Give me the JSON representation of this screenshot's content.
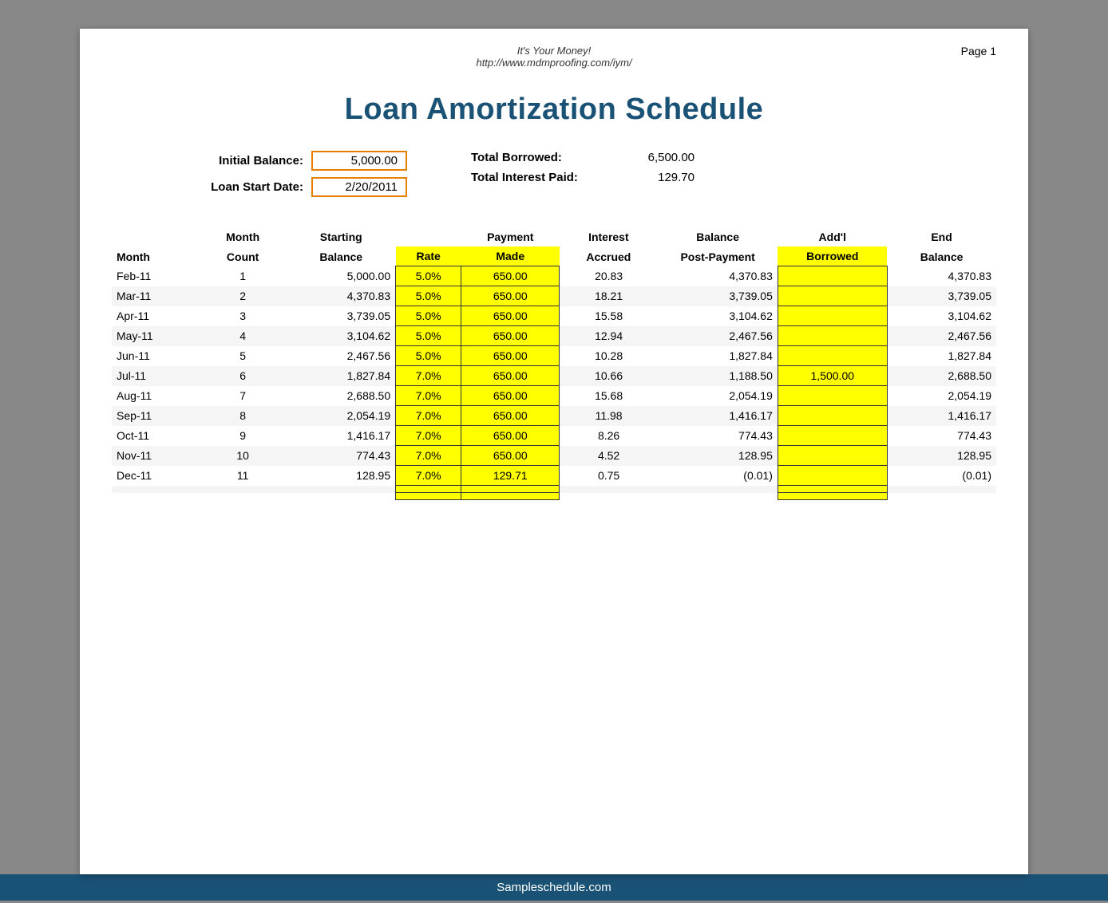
{
  "page": {
    "number": "Page 1",
    "site_title": "It's Your Money!",
    "site_url": "http://www.mdmproofing.com/iym/",
    "main_title": "Loan Amortization Schedule"
  },
  "info": {
    "initial_balance_label": "Initial Balance:",
    "initial_balance_value": "5,000.00",
    "loan_start_date_label": "Loan Start Date:",
    "loan_start_date_value": "2/20/2011",
    "total_borrowed_label": "Total Borrowed:",
    "total_borrowed_value": "6,500.00",
    "total_interest_label": "Total Interest Paid:",
    "total_interest_value": "129.70"
  },
  "table": {
    "headers": {
      "month": "Month",
      "month_count": "Month Count",
      "starting_balance": "Starting Balance",
      "rate": "Rate",
      "payment_made": "Payment Made",
      "interest_accrued": "Interest Accrued",
      "balance_post_payment": "Balance Post-Payment",
      "addl_borrowed": "Add'l Borrowed",
      "end_balance": "End Balance"
    },
    "rows": [
      {
        "month": "Feb-11",
        "count": "1",
        "starting": "5,000.00",
        "rate": "5.0%",
        "payment": "650.00",
        "interest": "20.83",
        "balance_post": "4,370.83",
        "addl": "",
        "end": "4,370.83"
      },
      {
        "month": "Mar-11",
        "count": "2",
        "starting": "4,370.83",
        "rate": "5.0%",
        "payment": "650.00",
        "interest": "18.21",
        "balance_post": "3,739.05",
        "addl": "",
        "end": "3,739.05"
      },
      {
        "month": "Apr-11",
        "count": "3",
        "starting": "3,739.05",
        "rate": "5.0%",
        "payment": "650.00",
        "interest": "15.58",
        "balance_post": "3,104.62",
        "addl": "",
        "end": "3,104.62"
      },
      {
        "month": "May-11",
        "count": "4",
        "starting": "3,104.62",
        "rate": "5.0%",
        "payment": "650.00",
        "interest": "12.94",
        "balance_post": "2,467.56",
        "addl": "",
        "end": "2,467.56"
      },
      {
        "month": "Jun-11",
        "count": "5",
        "starting": "2,467.56",
        "rate": "5.0%",
        "payment": "650.00",
        "interest": "10.28",
        "balance_post": "1,827.84",
        "addl": "",
        "end": "1,827.84"
      },
      {
        "month": "Jul-11",
        "count": "6",
        "starting": "1,827.84",
        "rate": "7.0%",
        "payment": "650.00",
        "interest": "10.66",
        "balance_post": "1,188.50",
        "addl": "1,500.00",
        "end": "2,688.50"
      },
      {
        "month": "Aug-11",
        "count": "7",
        "starting": "2,688.50",
        "rate": "7.0%",
        "payment": "650.00",
        "interest": "15.68",
        "balance_post": "2,054.19",
        "addl": "",
        "end": "2,054.19"
      },
      {
        "month": "Sep-11",
        "count": "8",
        "starting": "2,054.19",
        "rate": "7.0%",
        "payment": "650.00",
        "interest": "11.98",
        "balance_post": "1,416.17",
        "addl": "",
        "end": "1,416.17"
      },
      {
        "month": "Oct-11",
        "count": "9",
        "starting": "1,416.17",
        "rate": "7.0%",
        "payment": "650.00",
        "interest": "8.26",
        "balance_post": "774.43",
        "addl": "",
        "end": "774.43"
      },
      {
        "month": "Nov-11",
        "count": "10",
        "starting": "774.43",
        "rate": "7.0%",
        "payment": "650.00",
        "interest": "4.52",
        "balance_post": "128.95",
        "addl": "",
        "end": "128.95"
      },
      {
        "month": "Dec-11",
        "count": "11",
        "starting": "128.95",
        "rate": "7.0%",
        "payment": "129.71",
        "interest": "0.75",
        "balance_post": "(0.01)",
        "addl": "",
        "end": "(0.01)"
      },
      {
        "month": "",
        "count": "",
        "starting": "",
        "rate": "",
        "payment": "",
        "interest": "",
        "balance_post": "",
        "addl": "",
        "end": ""
      },
      {
        "month": "",
        "count": "",
        "starting": "",
        "rate": "",
        "payment": "",
        "interest": "",
        "balance_post": "",
        "addl": "",
        "end": ""
      }
    ]
  },
  "footer": {
    "text": "Sampleschedule.com"
  }
}
